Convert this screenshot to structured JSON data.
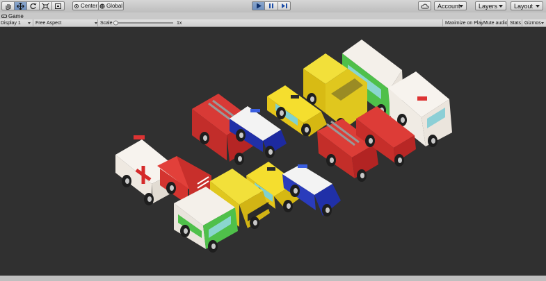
{
  "toolbar": {
    "pivot_label": "Center",
    "space_label": "Global",
    "account_label": "Account",
    "layers_label": "Layers",
    "layout_label": "Layout",
    "tools": [
      "hand-icon",
      "move-icon",
      "rotate-icon",
      "scale-icon",
      "rect-icon"
    ],
    "play_icon": "play-icon",
    "pause_icon": "pause-icon",
    "step_icon": "step-icon",
    "cloud_icon": "cloud-icon",
    "play_active_color": "#6d8fbf"
  },
  "tab": {
    "title": "Game"
  },
  "game_bar": {
    "display": "Display 1",
    "aspect": "Free Aspect",
    "scale_label": "Scale",
    "scale_value": "1x",
    "maximize": "Maximize on Play",
    "mute": "Mute audio",
    "stats": "Stats",
    "gizmos": "Gizmos"
  },
  "scene": {
    "background": "#303030",
    "vehicles": [
      "ambulance",
      "fire-truck",
      "police-car",
      "taxi",
      "pickup-truck",
      "minibus",
      "fire-truck",
      "taxi",
      "police-car",
      "fire-truck",
      "ambulance",
      "pickup-truck",
      "minibus",
      "fire-truck",
      "ambulance"
    ]
  }
}
